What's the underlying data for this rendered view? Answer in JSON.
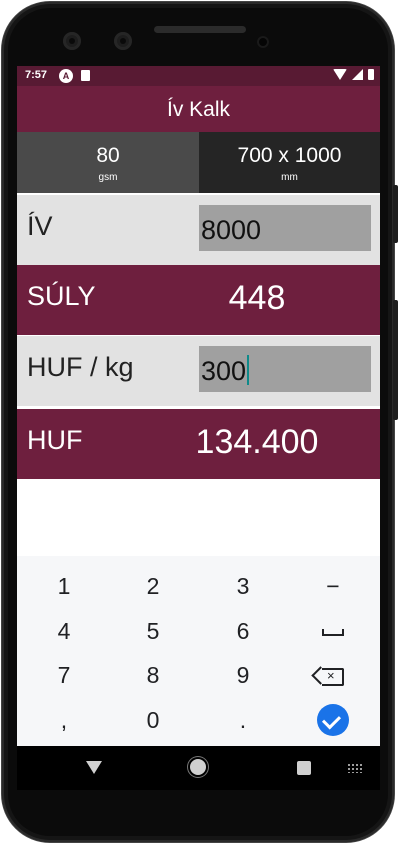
{
  "status_bar": {
    "time": "7:57",
    "app_icon": "a-circle-icon",
    "icons": [
      "sd-card-icon",
      "wifi-icon",
      "cellular-icon",
      "battery-icon"
    ]
  },
  "app": {
    "title": "Ív Kalk",
    "primary_color": "#6e1f3e"
  },
  "tabs": [
    {
      "value": "80",
      "unit": "gsm"
    },
    {
      "value": "700 x 1000",
      "unit": "mm"
    }
  ],
  "rows": {
    "sheets": {
      "label": "ÍV",
      "value": "8000"
    },
    "weight": {
      "label": "SÚLY",
      "value": "448"
    },
    "price_per_kg": {
      "label": "HUF / kg",
      "value": "300"
    },
    "total": {
      "label": "HUF",
      "value": "134.400"
    }
  },
  "keyboard": {
    "keys": [
      "1",
      "2",
      "3",
      "−",
      "4",
      "5",
      "6",
      "space",
      "7",
      "8",
      "9",
      "backspace",
      ",",
      "0",
      ".",
      "done"
    ]
  },
  "navbar": {
    "icons": [
      "back-icon",
      "home-icon",
      "recents-icon",
      "keyboard-switch-icon"
    ]
  }
}
